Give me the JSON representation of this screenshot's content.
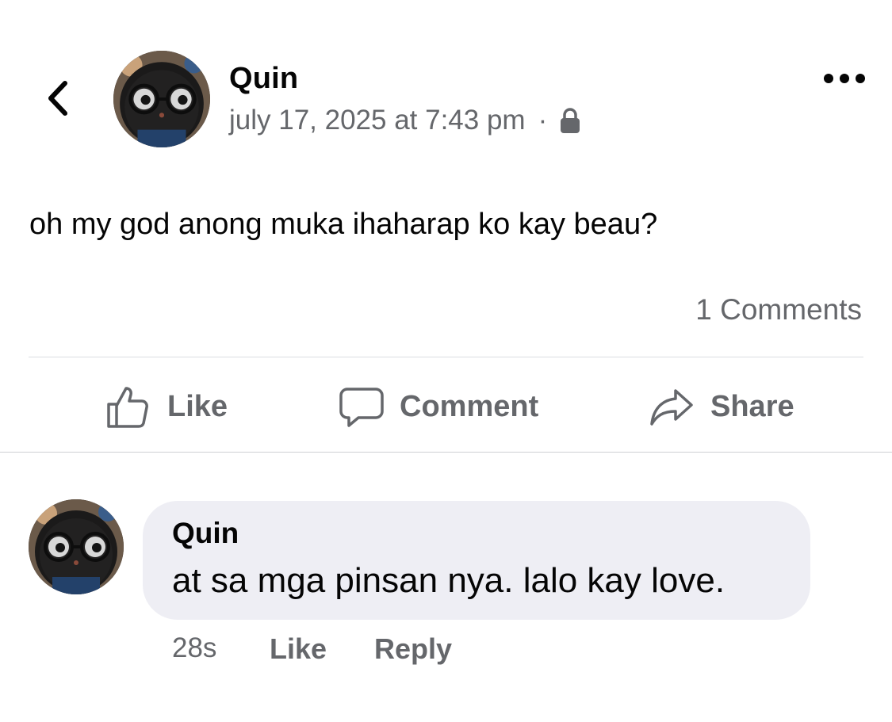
{
  "post": {
    "author": "Quin",
    "timestamp": "july 17, 2025 at 7:43 pm",
    "separator": "·",
    "privacy_icon": "lock-icon",
    "text": "oh my god anong muka ihaharap ko kay beau?",
    "comments_count": "1 Comments"
  },
  "header": {
    "back_icon": "chevron-left-icon",
    "more_icon": "more-horizontal-icon"
  },
  "actions": {
    "like": "Like",
    "comment": "Comment",
    "share": "Share"
  },
  "comment": {
    "author": "Quin",
    "text": "at sa mga pinsan nya. lalo kay love.",
    "time": "28s",
    "like": "Like",
    "reply": "Reply"
  },
  "colors": {
    "primary_text": "#050505",
    "secondary_text": "#65676b",
    "bubble_bg": "#eeeef4",
    "divider": "#dadde1"
  }
}
